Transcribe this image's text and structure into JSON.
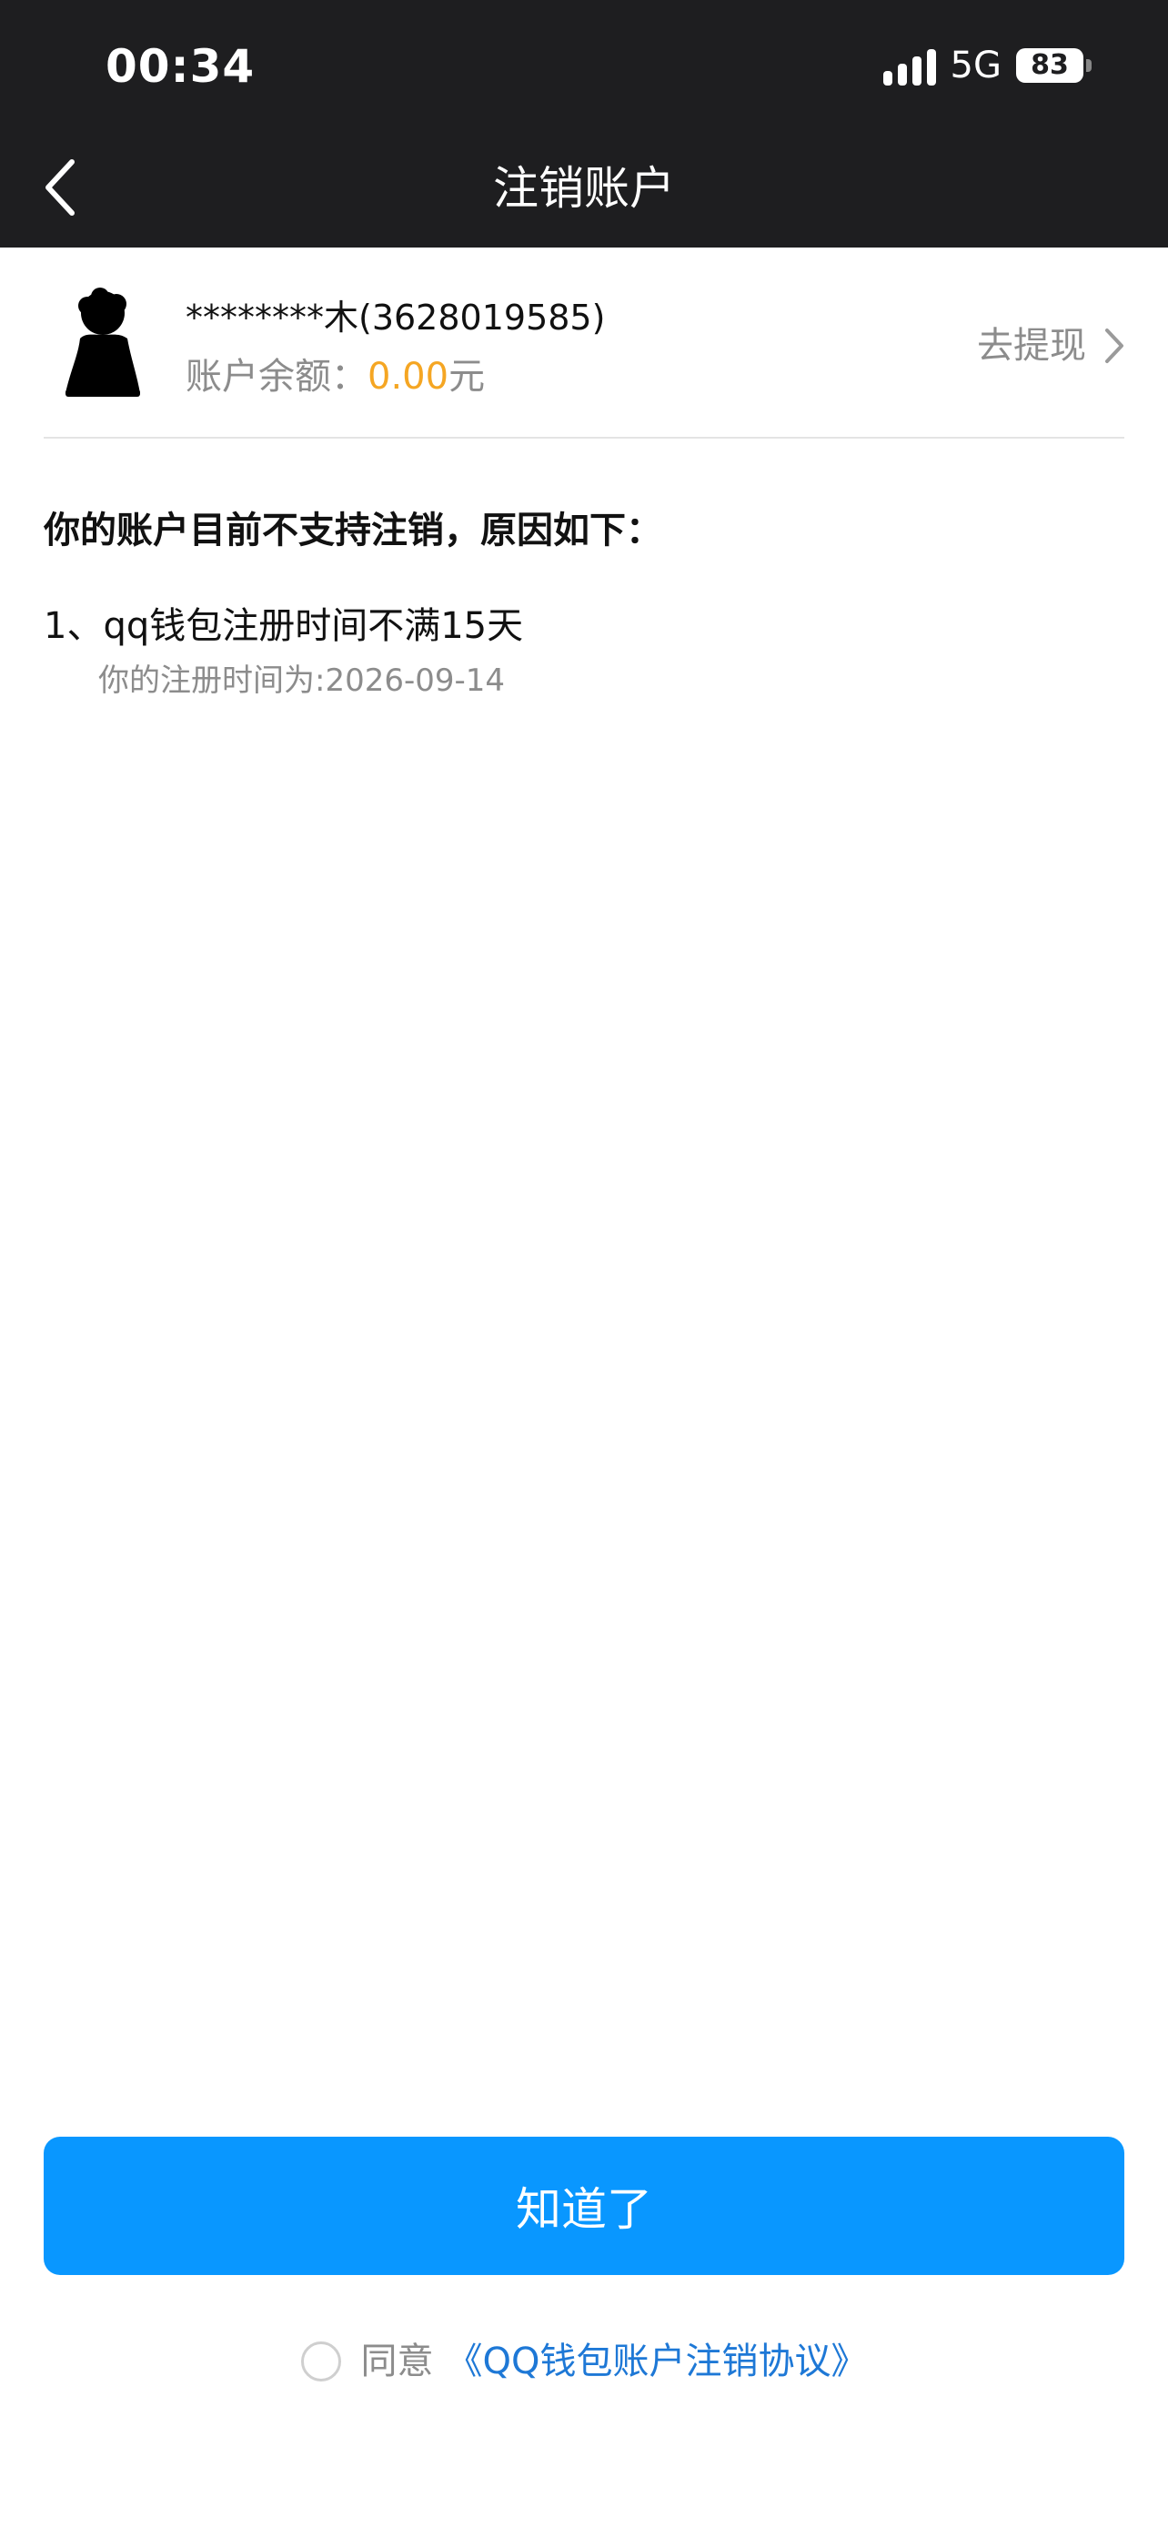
{
  "status_bar": {
    "time": "00:34",
    "network": "5G",
    "battery": "83"
  },
  "nav": {
    "title": "注销账户"
  },
  "account": {
    "name": "********木(3628019585)",
    "balance_label": "账户余额：",
    "balance_amount": "0.00",
    "balance_unit": "元",
    "withdraw_label": "去提现"
  },
  "reasons": {
    "heading": "你的账户目前不支持注销，原因如下：",
    "items": [
      {
        "title": "1、qq钱包注册时间不满15天",
        "detail": "你的注册时间为:2026-09-14"
      }
    ]
  },
  "confirm": {
    "label": "知道了"
  },
  "agreement": {
    "agree_text": "同意",
    "link_text": "《QQ钱包账户注销协议》",
    "checked": false
  },
  "colors": {
    "header_bg": "#1e1e20",
    "accent": "#0997ff",
    "balance_amount": "#f5a623",
    "link": "#1e78d6"
  }
}
